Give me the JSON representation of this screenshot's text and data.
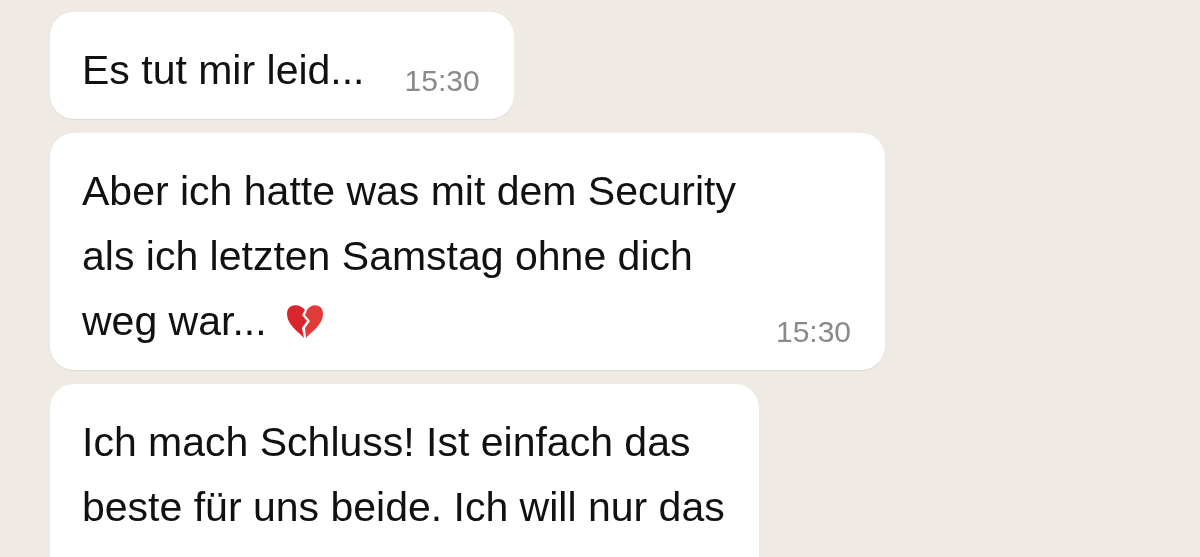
{
  "messages": [
    {
      "kind": "plain",
      "text": "Es tut mir leid...",
      "time": "15:30"
    },
    {
      "kind": "with-icon",
      "text": "Aber ich hatte was mit dem Security\nals ich letzten Samstag ohne dich\nweg war...",
      "time": "15:30"
    },
    {
      "kind": "plain",
      "text": "Ich mach Schluss! Ist einfach das\nbeste für uns beide. Ich will nur das"
    }
  ]
}
